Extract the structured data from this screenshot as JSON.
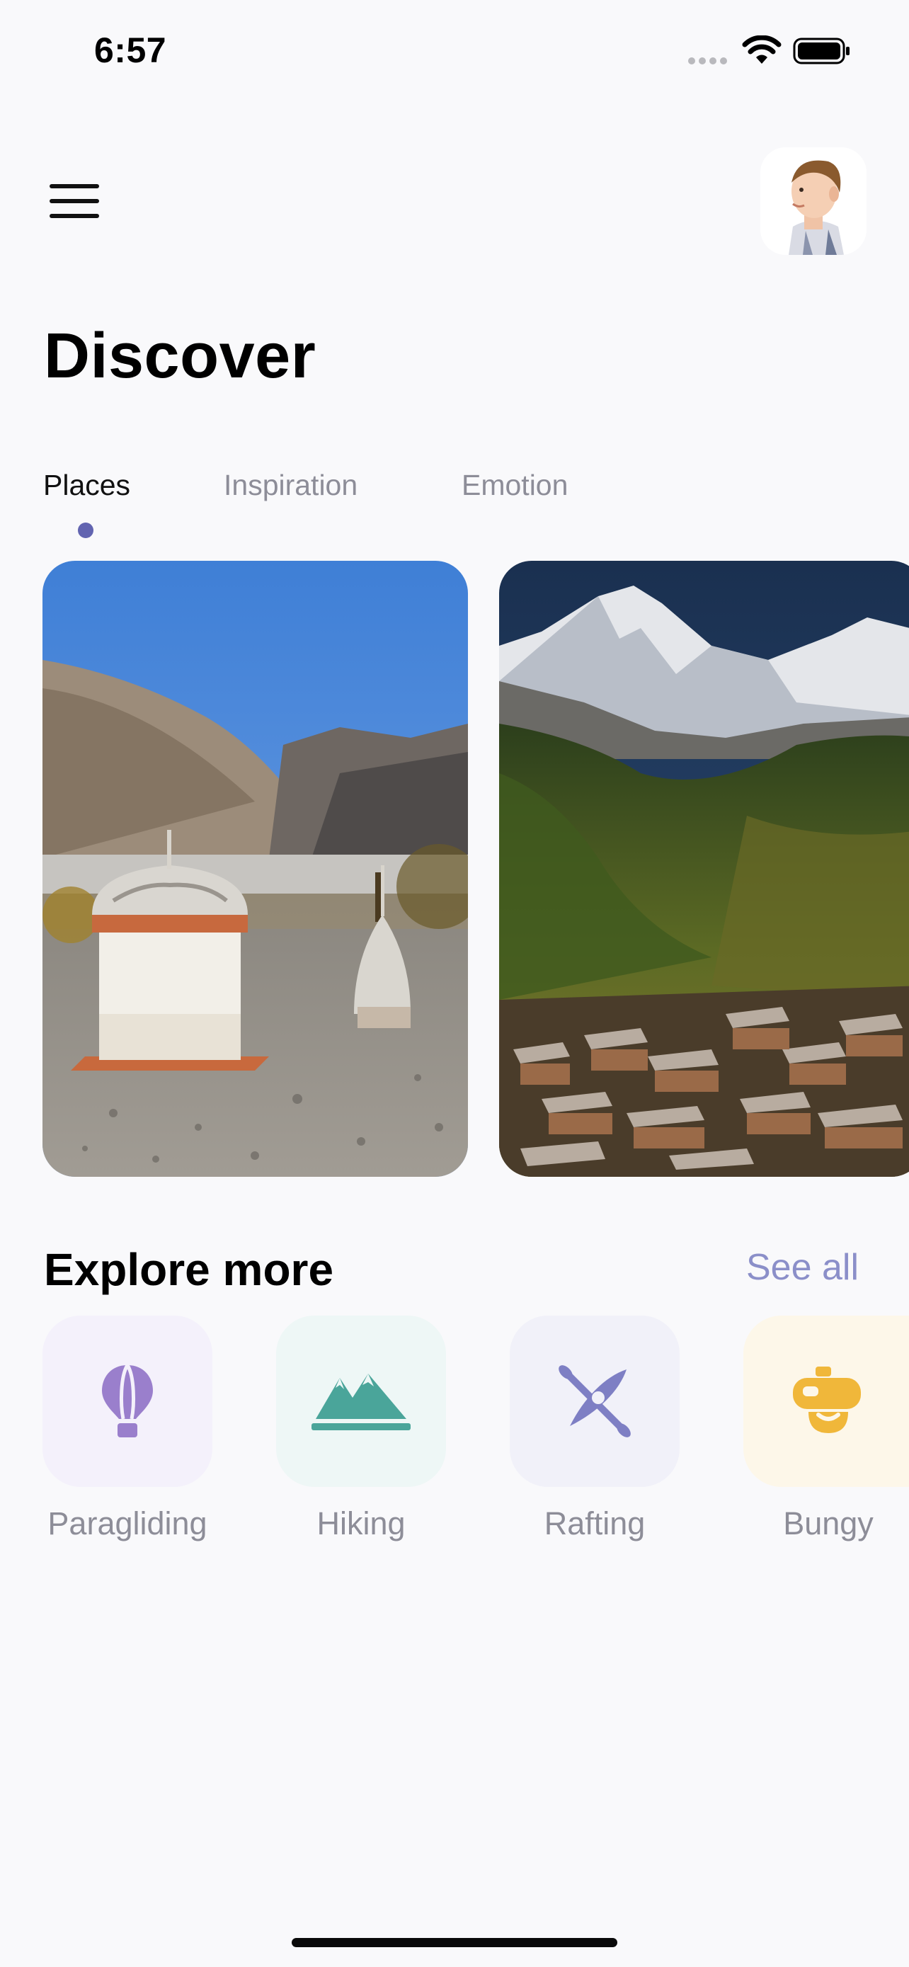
{
  "status_bar": {
    "time": "6:57"
  },
  "header": {
    "title": "Discover"
  },
  "tabs": [
    {
      "label": "Places",
      "active": true
    },
    {
      "label": "Inspiration",
      "active": false
    },
    {
      "label": "Emotion",
      "active": false
    }
  ],
  "explore": {
    "title": "Explore more",
    "see_all": "See all",
    "categories": [
      {
        "label": "Paragliding",
        "icon": "hot-air-balloon-icon",
        "tile_color": "#f4f1fb",
        "icon_color": "#9a7fcc"
      },
      {
        "label": "Hiking",
        "icon": "mountains-icon",
        "tile_color": "#eef7f6",
        "icon_color": "#4aa59a"
      },
      {
        "label": "Rafting",
        "icon": "kayak-icon",
        "tile_color": "#f1f1f9",
        "icon_color": "#7e7fc4"
      },
      {
        "label": "Bungy",
        "icon": "bungy-icon",
        "tile_color": "#fdf7e9",
        "icon_color": "#f0b73a"
      }
    ]
  },
  "colors": {
    "accent": "#6264b0",
    "see_all": "#8b8fc9",
    "background": "#f9f9fb"
  }
}
